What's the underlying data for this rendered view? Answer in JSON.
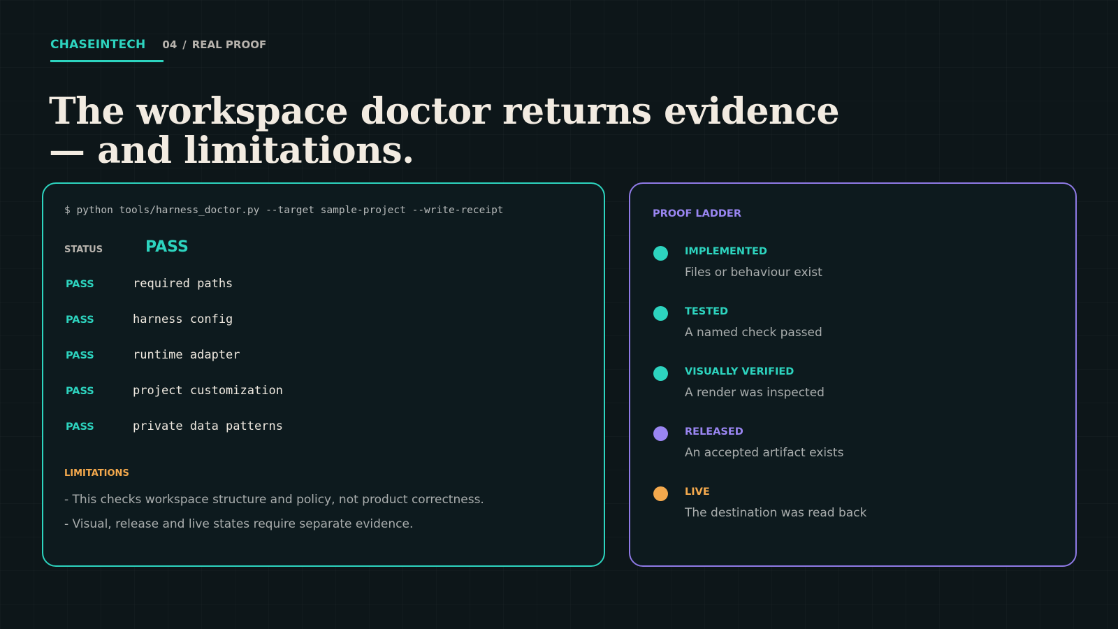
{
  "header": {
    "brand": "CHASEINTECH",
    "section_number": "04",
    "separator": "/",
    "section_name": "REAL PROOF"
  },
  "headline": {
    "line1": "The workspace doctor returns evidence",
    "line2": "— and limitations."
  },
  "terminal": {
    "command": "$ python tools/harness_doctor.py --target sample-project --write-receipt",
    "status_label": "STATUS",
    "status_value": "PASS",
    "checks": [
      {
        "result": "PASS",
        "name": "required paths"
      },
      {
        "result": "PASS",
        "name": "harness config"
      },
      {
        "result": "PASS",
        "name": "runtime adapter"
      },
      {
        "result": "PASS",
        "name": "project customization"
      },
      {
        "result": "PASS",
        "name": "private data patterns"
      }
    ],
    "limitations_title": "LIMITATIONS",
    "limitations": [
      "- This checks workspace structure and policy, not product correctness.",
      "- Visual, release and live states require separate evidence."
    ]
  },
  "proof_ladder": {
    "title": "PROOF LADDER",
    "steps": [
      {
        "name": "IMPLEMENTED",
        "description": "Files or behaviour exist",
        "color": "#2dd4bf"
      },
      {
        "name": "TESTED",
        "description": "A named check passed",
        "color": "#2dd4bf"
      },
      {
        "name": "VISUALLY VERIFIED",
        "description": "A render was inspected",
        "color": "#2dd4bf"
      },
      {
        "name": "RELEASED",
        "description": "An accepted artifact exists",
        "color": "#9a86f2"
      },
      {
        "name": "LIVE",
        "description": "The destination was read back",
        "color": "#f4a94d"
      }
    ]
  },
  "colors": {
    "background": "#0d1619",
    "teal": "#2dd4bf",
    "purple": "#9a86f2",
    "orange": "#f4a94d",
    "text": "#f2ebe1"
  }
}
